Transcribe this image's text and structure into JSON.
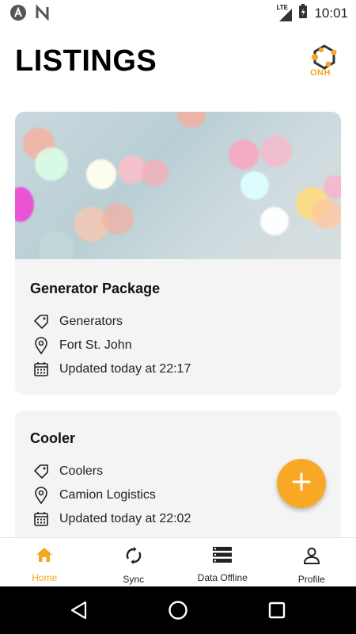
{
  "status_bar": {
    "time": "10:01",
    "network": "LTE"
  },
  "header": {
    "title": "LISTINGS",
    "logo_text": "ONH"
  },
  "listings": [
    {
      "title": "Generator Package",
      "category": "Generators",
      "location": "Fort St. John",
      "updated": "Updated today at 22:17"
    },
    {
      "title": "Cooler",
      "category": "Coolers",
      "location": "Camion Logistics",
      "updated": "Updated today at 22:02"
    }
  ],
  "fab": {
    "icon": "plus-icon"
  },
  "bottom_nav": {
    "items": [
      {
        "label": "Home",
        "icon": "home-icon",
        "active": true
      },
      {
        "label": "Sync",
        "icon": "sync-icon",
        "active": false
      },
      {
        "label": "Data Offline",
        "icon": "database-icon",
        "active": false
      },
      {
        "label": "Profile",
        "icon": "person-icon",
        "active": false
      }
    ]
  },
  "colors": {
    "accent": "#f9a825",
    "active_label": "#f5a623",
    "card_bg": "#f4f4f4"
  }
}
